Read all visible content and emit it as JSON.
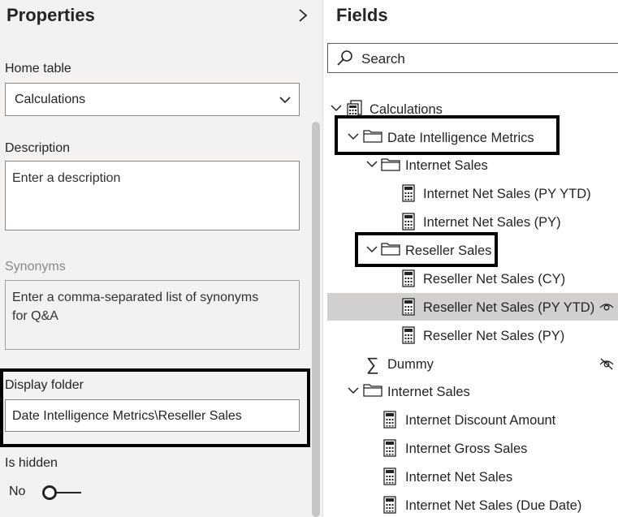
{
  "properties": {
    "title": "Properties",
    "home_table_label": "Home table",
    "home_table_value": "Calculations",
    "description_label": "Description",
    "description_placeholder": "Enter a description",
    "synonyms_label": "Synonyms",
    "synonyms_placeholder_line1": "Enter a comma-separated list of synonyms",
    "synonyms_placeholder_line2": "for Q&A",
    "display_folder_label": "Display folder",
    "display_folder_value": "Date Intelligence Metrics\\Reseller Sales",
    "is_hidden_label": "Is hidden",
    "is_hidden_value": "No"
  },
  "fields": {
    "title": "Fields",
    "search_placeholder": "Search",
    "tree": {
      "calculations": "Calculations",
      "date_intel_folder": "Date Intelligence Metrics",
      "internet_sales_folder": "Internet Sales",
      "internet_net_sales_py_ytd": "Internet Net Sales (PY YTD)",
      "internet_net_sales_py": "Internet Net Sales (PY)",
      "reseller_sales_folder": "Reseller Sales",
      "reseller_net_sales_cy": "Reseller Net Sales (CY)",
      "reseller_net_sales_py_ytd": "Reseller Net Sales (PY YTD)",
      "reseller_net_sales_py": "Reseller Net Sales (PY)",
      "dummy": "Dummy",
      "internet_sales_folder_2": "Internet Sales",
      "internet_discount_amount": "Internet Discount Amount",
      "internet_gross_sales": "Internet Gross Sales",
      "internet_net_sales": "Internet Net Sales",
      "internet_net_sales_due_date": "Internet Net Sales (Due Date)"
    }
  }
}
